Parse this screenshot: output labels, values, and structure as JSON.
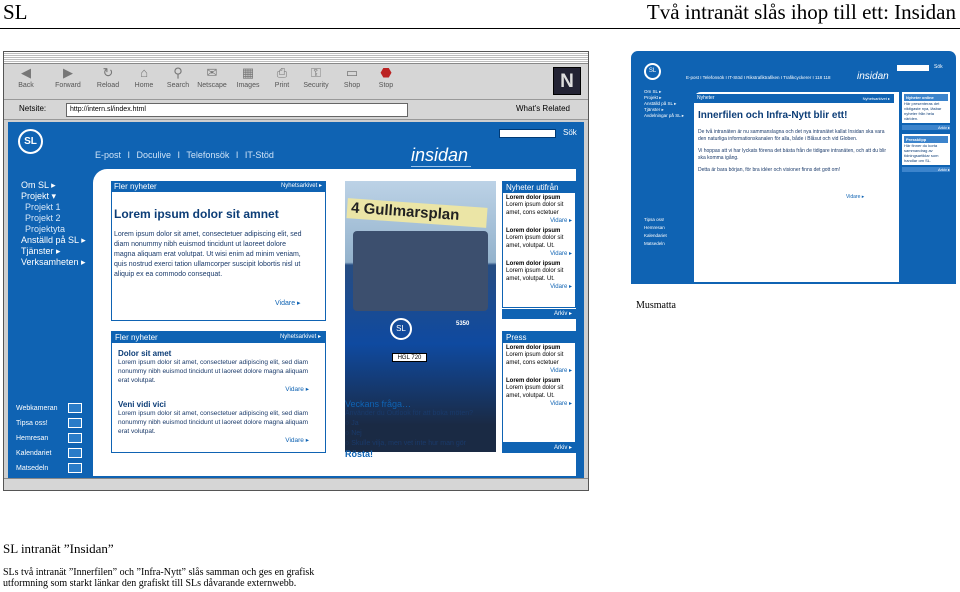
{
  "slide": {
    "title_left": "SL",
    "title_right": "Två intranät slås ihop till ett: Insidan",
    "caption_heading": "SL intranät ”Insidan”",
    "caption_body": "SLs två intranät ”Innerfilen” och ”Infra-Nytt” slås samman och ges en grafisk utformning som starkt länkar den grafiskt till SLs dåvarande externwebb.",
    "musmatta": "Musmatta"
  },
  "browser": {
    "toolbar": [
      {
        "label": "Back",
        "icon": "back-arrow-icon"
      },
      {
        "label": "Forward",
        "icon": "forward-arrow-icon"
      },
      {
        "label": "Reload",
        "icon": "reload-icon"
      },
      {
        "label": "Home",
        "icon": "home-icon"
      },
      {
        "label": "Search",
        "icon": "search-icon"
      },
      {
        "label": "Netscape",
        "icon": "netscape-icon"
      },
      {
        "label": "Images",
        "icon": "images-icon"
      },
      {
        "label": "Print",
        "icon": "print-icon"
      },
      {
        "label": "Security",
        "icon": "security-icon"
      },
      {
        "label": "Shop",
        "icon": "shop-icon"
      },
      {
        "label": "Stop",
        "icon": "stop-icon"
      }
    ],
    "netsite_label": "Netsite:",
    "url": "http://intern.sl/index.html",
    "related": "What's Related",
    "logo": "N"
  },
  "site": {
    "logo": "SL",
    "topnav": "E-post  I  Doculive  I  Telefonsök  I  IT-Stöd",
    "search_button": "Sök",
    "brand": "insidan",
    "leftnav": [
      "Om SL ▸",
      "Projekt ▾",
      "Projekt 1",
      "Projekt 2",
      "Projektyta",
      "Anställd på SL ▸",
      "Tjänster ▸",
      "Verksamheten ▸"
    ],
    "news": {
      "title": "Fler nyheter",
      "archive": "Nyhetsarkivet ▸",
      "headline": "Lorem ipsum dolor sit amnet",
      "body": "Lorem ipsum dolor sit amet, consectetuer adipiscing elit, sed diam nonummy nibh euismod tincidunt ut laoreet dolore magna aliquam erat volutpat. Ut wisi enim ad minim veniam, quis nostrud exerci tation ullamcorper suscipit lobortis nisl ut aliquip ex ea commodo consequat.",
      "more": "Vidare ▸"
    },
    "bus": {
      "sign": "4 Gullmarsplan",
      "plate": "HGL 720",
      "logo": "SL",
      "number": "5350"
    },
    "outside": {
      "title": "Nyheter utifrån",
      "items": [
        {
          "h": "Lorem dolor ipsum",
          "t": "Lorem ipsum dolor sit amet, cons ectetuer",
          "v": "Vidare ▸"
        },
        {
          "h": "Lorem dolor ipsum",
          "t": "Lorem ipsum dolor sit amet, volutpat. Ut.",
          "v": "Vidare ▸"
        },
        {
          "h": "Lorem dolor ipsum",
          "t": "Lorem ipsum dolor sit amet, volutpat. Ut.",
          "v": "Vidare ▸"
        }
      ],
      "archive": "Arkiv ▸"
    },
    "news2": {
      "title": "Fler nyheter",
      "archive": "Nyhetsarkivet ▸",
      "items": [
        {
          "h": "Dolor sit amet",
          "t": "Lorem ipsum dolor sit amet, consectetuer adipiscing elit, sed diam nonummy nibh euismod tincidunt ut laoreet dolore magna aliquam erat volutpat.",
          "v": "Vidare ▸"
        },
        {
          "h": "Veni vidi vici",
          "t": "Lorem ipsum dolor sit amet, consectetuer adipiscing elit, sed diam nonummy nibh euismod tincidunt ut laoreet dolore magna aliquam erat volutpat.",
          "v": "Vidare ▸"
        }
      ]
    },
    "poll": {
      "title": "Veckans fråga…",
      "question": "Använder du Outlook för att boka möten?",
      "options": [
        "Ja",
        "Nej",
        "Skulle vilja, men vet inte hur man gör"
      ],
      "vote": "Rösta!"
    },
    "press": {
      "title": "Press",
      "items": [
        {
          "h": "Lorem dolor ipsum",
          "t": "Lorem ipsum dolor sit amet, cons ectetuer",
          "v": "Vidare ▸"
        },
        {
          "h": "Lorem dolor ipsum",
          "t": "Lorem ipsum dolor sit amet, volutpat. Ut.",
          "v": "Vidare ▸"
        }
      ],
      "archive": "Arkiv ▸"
    },
    "leftbottom": [
      "Webkameran",
      "Tipsa oss!",
      "Hemresan",
      "Kalendariet",
      "Matsedeln"
    ]
  },
  "mini": {
    "logo": "SL",
    "topnav": "E-post  I  Telefonsök  I  IT-Stöd  I  Rikstrafiktrafiken  I  Trafikcyckerer  I  118 118",
    "brand": "insidan",
    "search": "Sök",
    "leftnav": [
      "Om SL ▸",
      "Projekt ▸",
      "Anställd på SL ▸",
      "Tjänster ▸",
      "Avdelningar på SL ▸"
    ],
    "leftbottom": [
      "Tipsa oss!",
      "Hemresan",
      "Kalendariet",
      "Matsedeln"
    ],
    "bar": "Nyheter",
    "bar_right": "Nyhetsarkivet ▸",
    "headline": "Innerfilen och Infra-Nytt blir ett!",
    "paragraphs": [
      "De två intranäten är nu sammanslagna och det nya intranätet kallat Insidan ska vara den naturliga informationskanalen för alla, både i Blåsut och vid Globen.",
      "Vi hoppas att vi har lyckats förena det bästa från de tidigare intranäten, och att du blir ska komma igång.",
      "Detta är bara början, för bra idéer och visioner finns det gott om!"
    ],
    "more": "Vidare ▸",
    "right": [
      {
        "hd": "Nyheter online",
        "t": "Här presenteras det viktigaste nya, läsbar nyheter från hela världen.",
        "a": "Arkiv ▸"
      },
      {
        "hd": "Pressklipp",
        "t": "Här finner du korta sammandrag av tidningsartiklar som handlar om SL.",
        "a": "Arkiv ▸"
      }
    ]
  }
}
